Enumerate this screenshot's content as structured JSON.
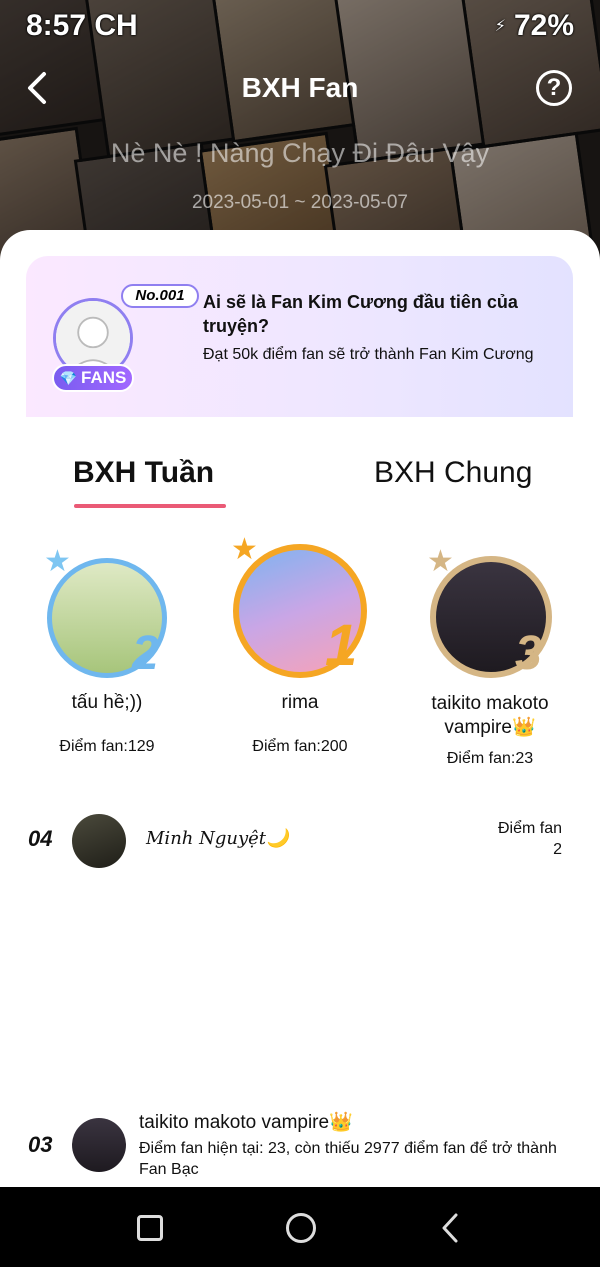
{
  "status_bar": {
    "time": "8:57 CH",
    "battery": "72%",
    "charging_icon": "bolt-icon"
  },
  "header": {
    "title": "BXH Fan",
    "back_icon": "chevron-left-icon",
    "help_icon": "question-circle-icon",
    "help_glyph": "?",
    "book_title": "Nè Nè ! Nàng Chạy Đi Đâu Vậy",
    "date_range": "2023-05-01 ~ 2023-05-07"
  },
  "promo": {
    "no_badge": "No.001",
    "fans_badge": "FANS",
    "diamond_glyph": "💎",
    "title": "Ai sẽ là Fan Kim Cương đầu tiên của truyện?",
    "subtitle": "Đạt 50k điểm fan sẽ trở thành Fan Kim Cương"
  },
  "tabs": [
    {
      "label": "BXH Tuần",
      "active": true
    },
    {
      "label": "BXH Chung",
      "active": false
    }
  ],
  "podium": [
    {
      "rank": "2",
      "name": "tấu hề;))",
      "score": "Điểm fan:129",
      "color": "#6fb7ee",
      "star": "★"
    },
    {
      "rank": "1",
      "name": "rima",
      "score": "Điểm fan:200",
      "color": "#f5a623",
      "star": "★"
    },
    {
      "rank": "3",
      "name": "taikito makoto vampire👑",
      "score": "Điểm fan:23",
      "color": "#d5b685",
      "star": "★"
    }
  ],
  "list": [
    {
      "rank": "04",
      "name": "Minh Nguyệt🌙",
      "score_label": "Điểm fan",
      "score": "2"
    }
  ],
  "my_rank": {
    "rank": "03",
    "name": "taikito makoto vampire👑",
    "desc": "Điểm fan hiện tại: 23, còn thiếu 2977 điểm fan để trở thành Fan Bạc"
  },
  "colors": {
    "accent_underline": "#ea5a76",
    "fans_badge": "#7a5cf0"
  }
}
